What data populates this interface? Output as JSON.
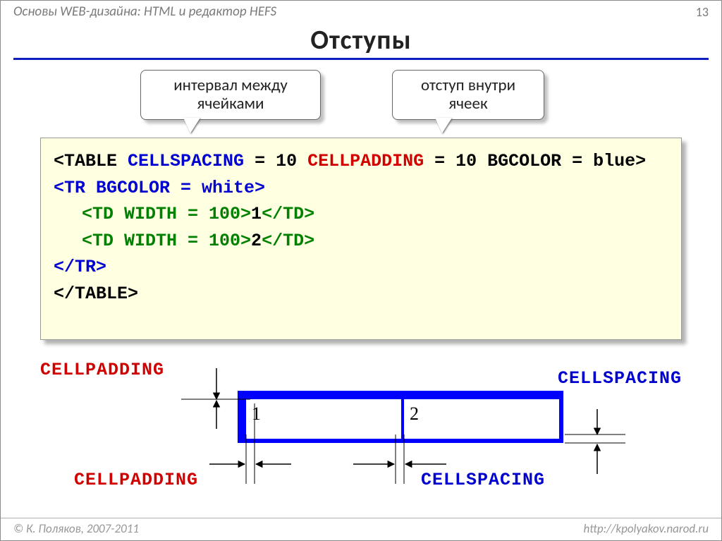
{
  "header": {
    "subject": "Основы WEB-дизайна: HTML и редактор HEFS",
    "page": "13"
  },
  "title": "Отступы",
  "callouts": {
    "cellspacing": "интервал между ячейками",
    "cellpadding": "отступ внутри ячеек"
  },
  "code": {
    "l1": {
      "a": "<TABLE ",
      "b": "CELLSPACING",
      "c": " = 10 ",
      "d": "CELLPADDING",
      "e": " = 10 BGCOLOR = blue>"
    },
    "l2": "<TR BGCOLOR = white>",
    "l3": {
      "a": "<TD WIDTH = 100>",
      "b": "1",
      "c": "</TD>"
    },
    "l4": {
      "a": "<TD WIDTH = 100>",
      "b": "2",
      "c": "</TD>"
    },
    "l5": "</TR>",
    "l6": "</TABLE>"
  },
  "diagram": {
    "cellpadding_top": "CELLPADDING",
    "cellspacing_top": "CELLSPACING",
    "cellpadding_bottom": "CELLPADDING",
    "cellspacing_bottom": "CELLSPACING",
    "cell1": "1",
    "cell2": "2"
  },
  "footer": {
    "copyright": "© К. Поляков, 2007-2011",
    "url": "http://kpolyakov.narod.ru"
  },
  "colors": {
    "accent_blue": "#0000ff",
    "text_blue": "#0000d0",
    "text_red": "#d00000",
    "text_green": "#008000",
    "code_bg": "#ffffe1"
  }
}
